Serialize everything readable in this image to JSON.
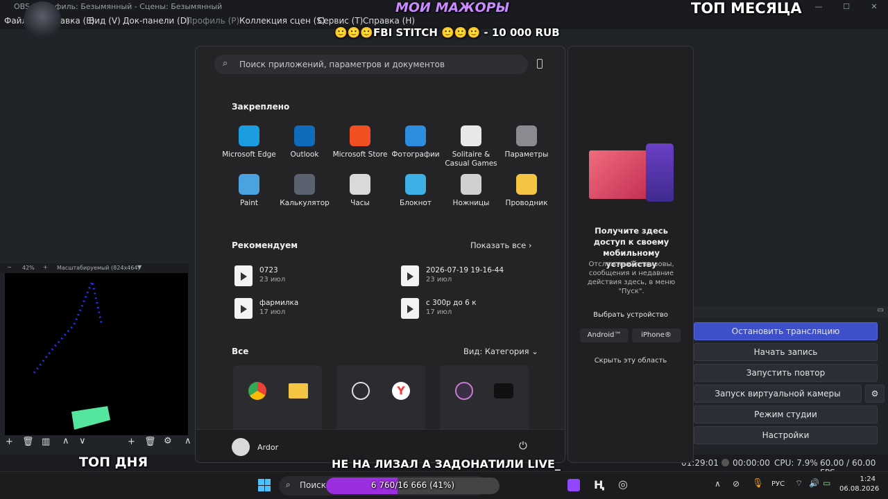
{
  "window": {
    "title": "OBS 3   Профиль: Безымянный - Сцены: Безымянный"
  },
  "menu": [
    "Файл",
    "Правка (E)",
    "Вид (V)",
    "Док-панели (D)",
    "Профиль (P)",
    "Коллекция сцен (S)",
    "Сервис (T)",
    "Справка (H)"
  ],
  "overlay": {
    "top_center": "МОИ МАЖОРЫ",
    "top_right": "ТОП МЕСЯЦА",
    "donation": "FBI STITCH",
    "donation_amount": "- 10 000 RUB",
    "bottom_left": "ТОП ДНЯ",
    "bottom_center": "НЕ НА ЛИЗАЛ А ЗАДОНАТИЛИ LIVE_",
    "goal": "6 760/16 666 (41%)",
    "goal_progress": 0.41
  },
  "preview": {
    "zoom": "42%",
    "mode": "Масштабируемый (824x464)"
  },
  "controls": [
    "Остановить трансляцию",
    "Начать запись",
    "Запустить повтор",
    "Запуск виртуальной камеры",
    "Режим студии",
    "Настройки"
  ],
  "status": {
    "time_live": "01:29:01",
    "time_rec": "00:00:00",
    "cpu": "CPU: 7.9%",
    "fps": "60.00 / 60.00 FPS"
  },
  "start": {
    "search_placeholder": "Поиск приложений, параметров и документов",
    "pinned_title": "Закреплено",
    "pinned": [
      {
        "label": "Microsoft Edge",
        "icon": "edge-icon",
        "color": "#1b9de2"
      },
      {
        "label": "Outlook",
        "icon": "outlook-icon",
        "color": "#0f6cbd"
      },
      {
        "label": "Microsoft Store",
        "icon": "store-icon",
        "color": "#f25022"
      },
      {
        "label": "Фотографии",
        "icon": "photos-icon",
        "color": "#2d8de0"
      },
      {
        "label": "Solitaire & Casual Games",
        "icon": "solitaire-icon",
        "color": "#e8e8e8"
      },
      {
        "label": "Параметры",
        "icon": "gear-icon",
        "color": "#8a8a90"
      },
      {
        "label": "Paint",
        "icon": "paint-icon",
        "color": "#4aa3df"
      },
      {
        "label": "Калькулятор",
        "icon": "calculator-icon",
        "color": "#5a6270"
      },
      {
        "label": "Часы",
        "icon": "clock-icon",
        "color": "#d9d9d9"
      },
      {
        "label": "Блокнот",
        "icon": "notepad-icon",
        "color": "#3db0e6"
      },
      {
        "label": "Ножницы",
        "icon": "snipping-icon",
        "color": "#d0d0d0"
      },
      {
        "label": "Проводник",
        "icon": "folder-icon",
        "color": "#f4c542"
      }
    ],
    "recommended_title": "Рекомендуем",
    "show_all": "Показать все",
    "recommended": [
      {
        "name": "0723",
        "date": "23 июл"
      },
      {
        "name": "2026-07-19 19-16-44",
        "date": "23 июл"
      },
      {
        "name": "фармилка",
        "date": "17 июл"
      },
      {
        "name": "с 300р до  6 к",
        "date": "17 июл"
      }
    ],
    "all_title": "Все",
    "view_label": "Вид: Категория",
    "user": "Ardor"
  },
  "side": {
    "heading": "Получите здесь доступ к своему мобильному устройству",
    "desc": "Отслеживайте вызовы, сообщения и недавние действия здесь, в меню \"Пуск\".",
    "choose": "Выбрать устройство",
    "android": "Android™",
    "iphone": "iPhone®",
    "hide": "Скрыть эту область"
  },
  "taskbar": {
    "search": "Поиск",
    "lang": "РУС",
    "time": "1:24",
    "date": "06.08.2026"
  }
}
